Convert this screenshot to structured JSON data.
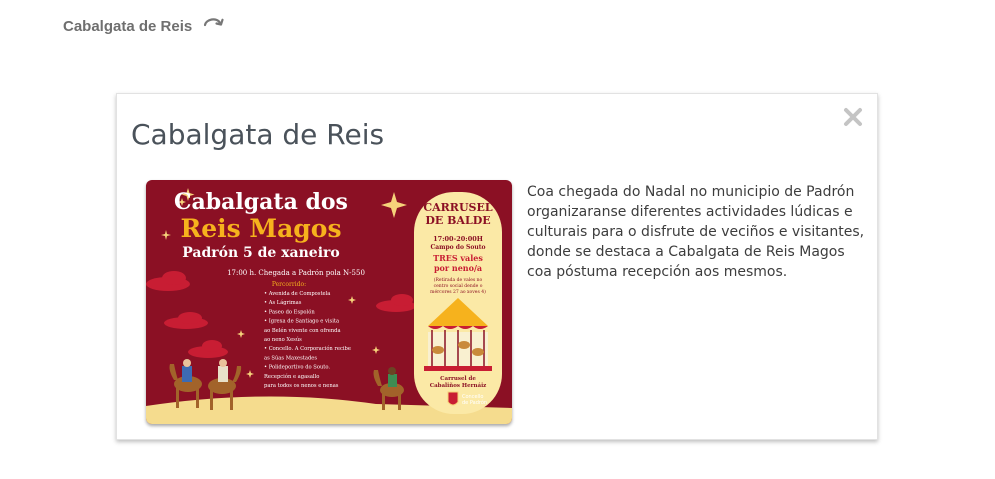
{
  "breadcrumb": {
    "title": "Cabalgata de Reis",
    "reload_icon": "reload-icon"
  },
  "modal": {
    "title": "Cabalgata de Reis",
    "close_icon": "close-icon",
    "description": "Coa chegada do Nadal no municipio de Padrón organizaranse diferentes actividades lúdicas e culturais para o disfrute de veciños e visitantes, donde se destaca a Cabalgata de Reis Magos coa póstuma recepción aos mesmos."
  },
  "poster": {
    "heading_line1": "Cabalgata dos",
    "heading_line2": "Reis Magos",
    "date_line": "Padrón 5 de xaneiro",
    "arrival": "17:00 h.  Chegada a Padrón pola N-550",
    "route_title": "Percorrido:",
    "route_items": [
      "• Avenida de Compostela",
      "• As Lágrimas",
      "• Paseo do Espolón",
      "• Igrexa de Santiago e visita",
      "  ao Belén vivente con ofrenda",
      "  ao neno Xesús",
      "• Concello. A Corporación recibe",
      "  as Súas Maxestades",
      "• Polideportivo do Souto.",
      "  Recepción e agasallo",
      "  para todos os nenos e nenas"
    ],
    "carrusel_line1": "CARRUSEL",
    "carrusel_line2": "DE BALDE",
    "carrusel_time": "17:00-20:00H",
    "carrusel_place": "Campo do Souto",
    "vales_line1": "TRES vales",
    "vales_line2": "por neno/a",
    "vales_note1": "(Retirada de vales no",
    "vales_note2": "centro social dende o",
    "vales_note3": "mércores 27 ao xoves 4)",
    "carrusel_credit1": "Carrusel de",
    "carrusel_credit2": "Cabaliños Hernáiz",
    "concello_line1": "Concello",
    "concello_line2": "de Padrón",
    "colors": {
      "background": "#8b1024",
      "gold": "#f6b21d",
      "cream": "#fbe9a6",
      "text": "#ffffff"
    }
  }
}
